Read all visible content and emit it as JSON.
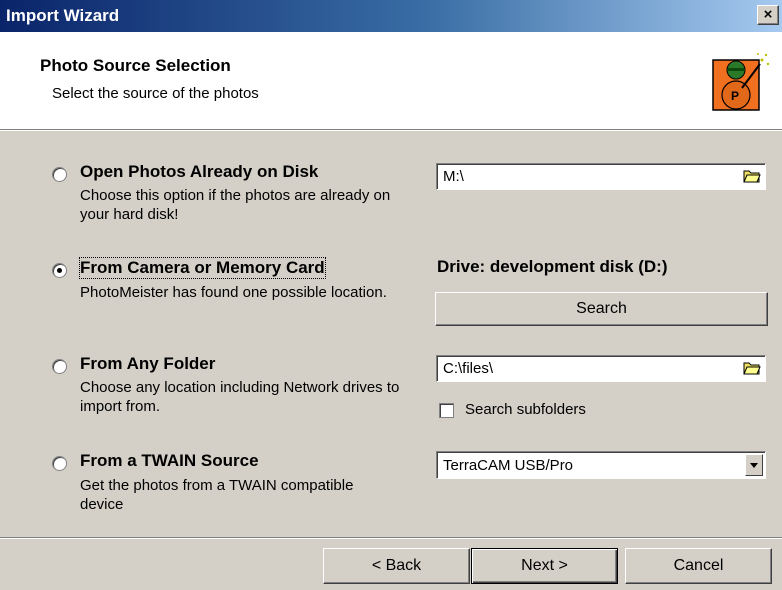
{
  "window": {
    "title": "Import Wizard",
    "close_label": "×"
  },
  "header": {
    "title": "Photo Source Selection",
    "subtitle": "Select the source of the photos",
    "logo_icon": "wizard-mascot-icon"
  },
  "options": [
    {
      "title": "Open Photos Already on Disk",
      "description": "Choose this option if the photos are already on your hard disk!",
      "selected": false
    },
    {
      "title": "From Camera or Memory Card",
      "description": "PhotoMeister has found one possible location.",
      "selected": true
    },
    {
      "title": "From Any Folder",
      "description": "Choose any location including Network drives to import from.",
      "selected": false
    },
    {
      "title": "From a TWAIN Source",
      "description": "Get the photos from a TWAIN compatible device",
      "selected": false
    }
  ],
  "disk": {
    "path": "M:\\"
  },
  "camera": {
    "drive_label": "Drive: development disk (D:)",
    "search_label": "Search"
  },
  "folder": {
    "path": "C:\\files\\",
    "subfolders_label": "Search subfolders",
    "subfolders_checked": false
  },
  "twain": {
    "selected": "TerraCAM USB/Pro"
  },
  "footer": {
    "back_label": "Back",
    "next_label": "Next",
    "cancel_label": "Cancel"
  },
  "colors": {
    "title_bar": "#0a246a",
    "face": "#d4d0c8"
  }
}
